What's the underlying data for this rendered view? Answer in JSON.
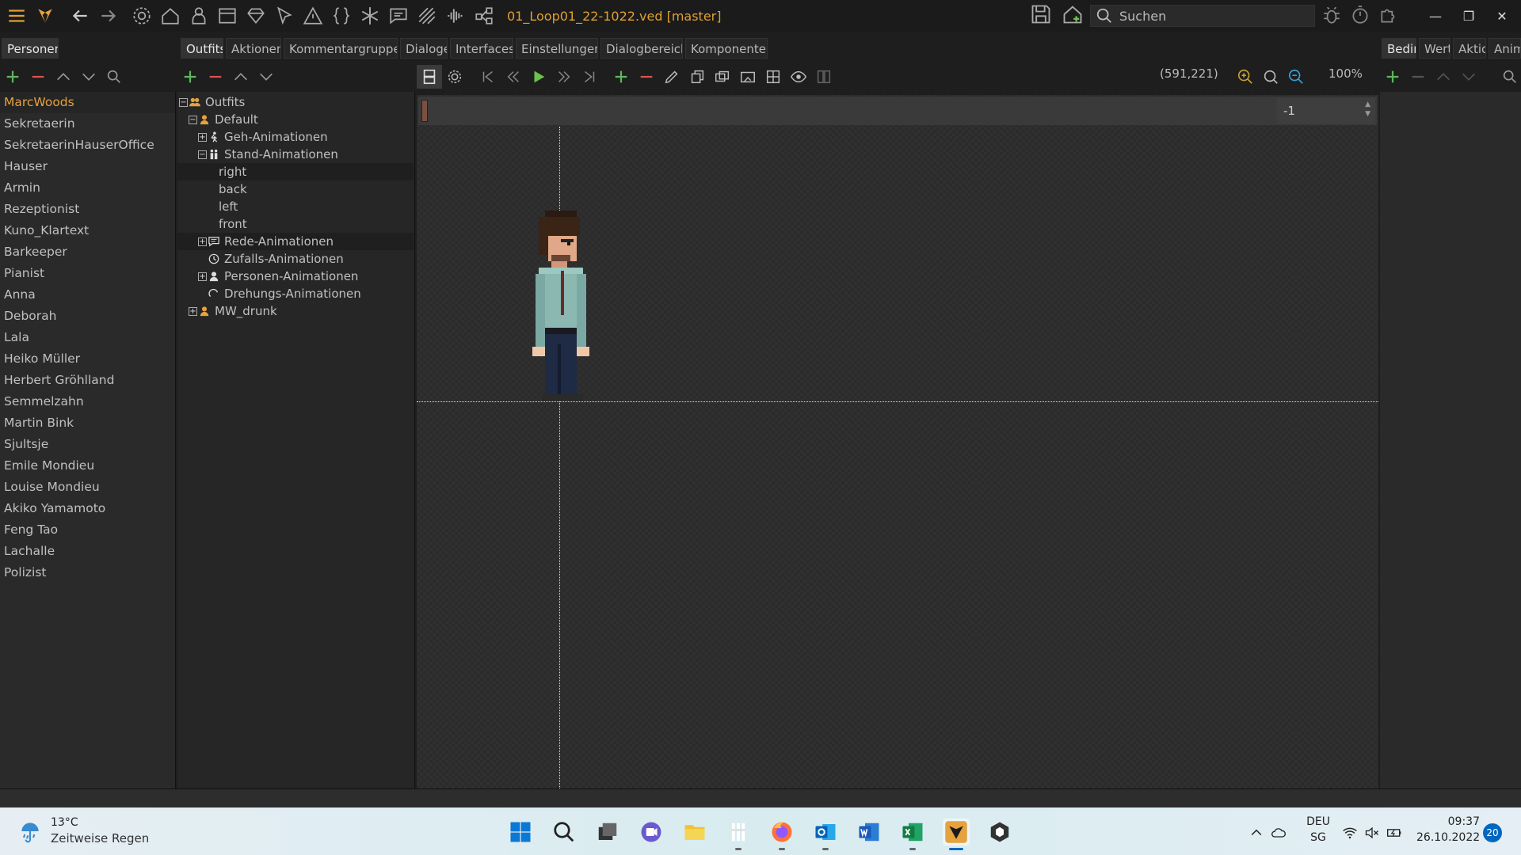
{
  "titlebar": {
    "doc_title": "01_Loop01_22-1022.ved [master]",
    "search_placeholder": "Suchen"
  },
  "tabs": {
    "left_panel": "Personen",
    "main": [
      "Outfits",
      "Aktionen",
      "Kommentargruppen",
      "Dialoge",
      "Interfaces",
      "Einstellungen",
      "Dialogbereich",
      "Komponenten"
    ],
    "right": [
      "Bedin",
      "Werte",
      "Aktio",
      "Anim"
    ]
  },
  "persons": [
    "MarcWoods",
    "Sekretaerin",
    "SekretaerinHauserOffice",
    "Hauser",
    "Armin",
    "Rezeptionist",
    "Kuno_Klartext",
    "Barkeeper",
    "Pianist",
    "Anna",
    "Deborah",
    "Lala",
    "Heiko Müller",
    "Herbert Gröhlland",
    "Semmelzahn",
    "Martin Bink",
    "Sjultsje",
    "Emile Mondieu",
    "Louise Mondieu",
    "Akiko Yamamoto",
    "Feng Tao",
    "Lachalle",
    "Polizist"
  ],
  "tree": {
    "root": "Outfits",
    "default": "Default",
    "geh": "Geh-Animationen",
    "stand": "Stand-Animationen",
    "right": "right",
    "back": "back",
    "left": "left",
    "front": "front",
    "rede": "Rede-Animationen",
    "zufalls": "Zufalls-Animationen",
    "personen": "Personen-Animationen",
    "drehungs": "Drehungs-Animationen",
    "mw_drunk": "MW_drunk"
  },
  "canvas": {
    "coords": "(591,221)",
    "zoom": "100%",
    "frame_value": "-1"
  },
  "taskbar": {
    "temp": "13°C",
    "weather": "Zeitweise Regen",
    "lang": "DEU",
    "region": "SG",
    "time": "09:37",
    "date": "26.10.2022",
    "notifications": "20"
  },
  "colors": {
    "accent": "#e6a23c",
    "play_green": "#6cc24a",
    "add_green": "#5cb85c",
    "remove_red": "#d9534f"
  }
}
